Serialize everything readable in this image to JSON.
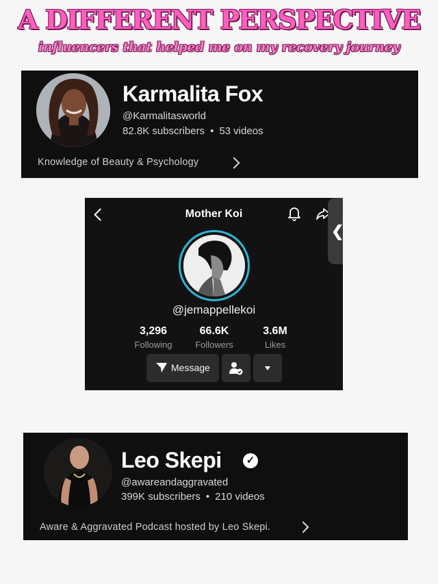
{
  "header": {
    "title": "A DIFFERENT PERSPECTIVE",
    "subtitle": "influencers that helped me on my recovery journey"
  },
  "channel_1": {
    "name": "Karmalita Fox",
    "handle": "@Karmalitasworld",
    "subscribers": "82.8K subscribers",
    "separator": "•",
    "videos": "53 videos",
    "description": "Knowledge of Beauty & Psychology"
  },
  "tiktok": {
    "title": "Mother Koi",
    "handle": "@jemappellekoi",
    "stats": [
      {
        "value": "3,296",
        "label": "Following"
      },
      {
        "value": "66.6K",
        "label": "Followers"
      },
      {
        "value": "3.6M",
        "label": "Likes"
      }
    ],
    "message_label": "Message",
    "side_tab_glyph": "❮"
  },
  "channel_2": {
    "name": "Leo Skepi",
    "handle": "@awareandaggravated",
    "subscribers": "399K subscribers",
    "separator": "•",
    "videos": "210 videos",
    "description": "Aware & Aggravated Podcast hosted by Leo Skepi.",
    "verified_glyph": "✓"
  },
  "colors": {
    "title_pink": "#ff5fbf",
    "card_bg": "#0f0f0f",
    "tiktok_ring": "#2fb6d6"
  }
}
